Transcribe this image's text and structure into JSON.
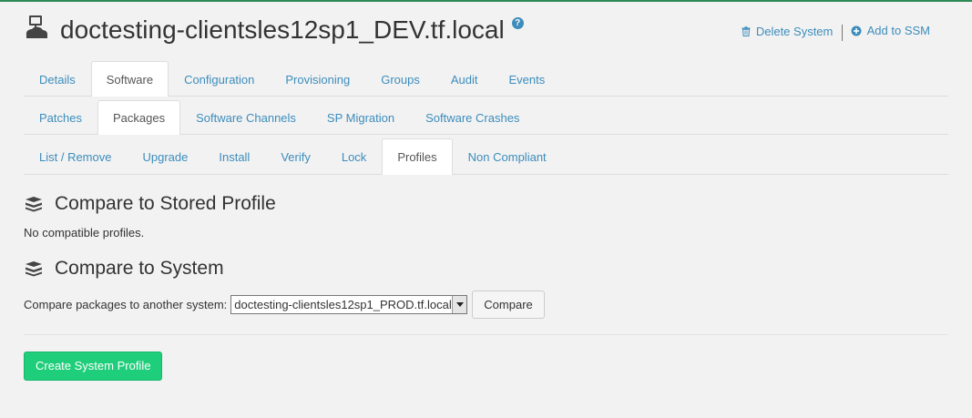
{
  "header": {
    "title": "doctesting-clientsles12sp1_DEV.tf.local",
    "help_glyph": "?",
    "delete_label": "Delete System",
    "add_ssm_label": "Add to SSM"
  },
  "tabs_level1": [
    "Details",
    "Software",
    "Configuration",
    "Provisioning",
    "Groups",
    "Audit",
    "Events"
  ],
  "tabs_level2": [
    "Patches",
    "Packages",
    "Software Channels",
    "SP Migration",
    "Software Crashes"
  ],
  "tabs_level3": [
    "List / Remove",
    "Upgrade",
    "Install",
    "Verify",
    "Lock",
    "Profiles",
    "Non Compliant"
  ],
  "active": {
    "level1": "Software",
    "level2": "Packages",
    "level3": "Profiles"
  },
  "stored_profile": {
    "title": "Compare to Stored Profile",
    "message": "No compatible profiles."
  },
  "compare_system": {
    "title": "Compare to System",
    "label": "Compare packages to another system:",
    "selected": "doctesting-clientsles12sp1_PROD.tf.local",
    "button": "Compare"
  },
  "create_button": "Create System Profile",
  "colors": {
    "accent": "#3c8dbc",
    "success": "#1fce7a",
    "top_line": "#2e8b57"
  },
  "icons": {
    "system": "system-computer-icon",
    "help": "help-circle-icon",
    "delete": "trash-icon",
    "add": "plus-circle-icon",
    "section": "boxes-icon"
  }
}
